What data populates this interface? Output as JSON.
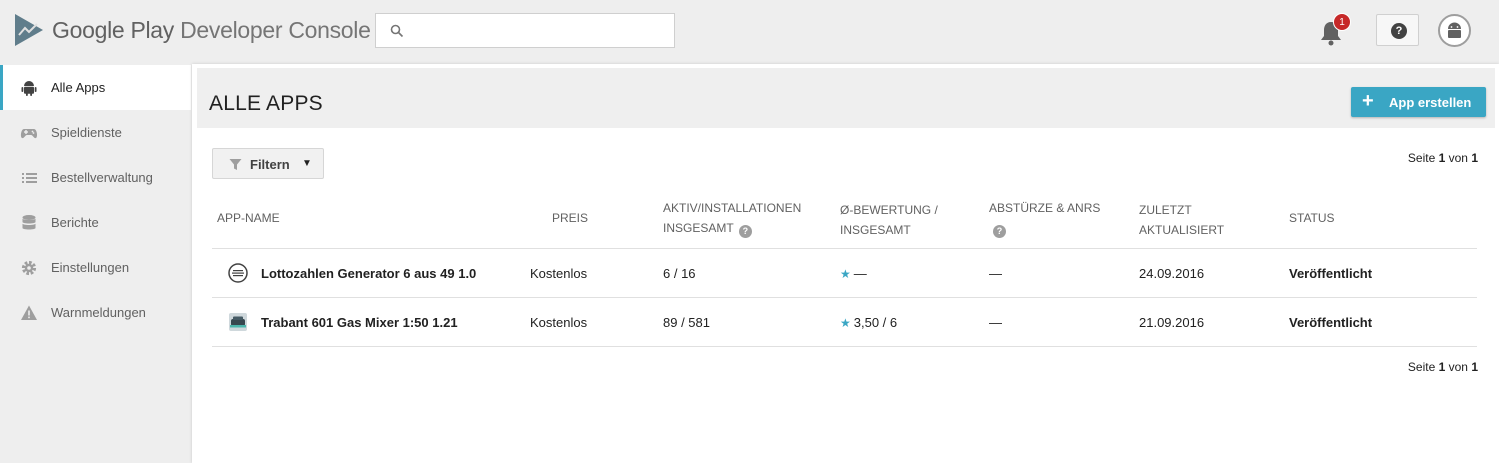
{
  "header": {
    "brand_part1": "Google Play",
    "brand_part2": " Developer Console",
    "search_placeholder": "",
    "notification_count": "1",
    "help_label": "?"
  },
  "sidebar": {
    "items": [
      {
        "label": "Alle Apps",
        "icon": "android-icon",
        "active": true
      },
      {
        "label": "Spieldienste",
        "icon": "gamepad-icon"
      },
      {
        "label": "Bestellverwaltung",
        "icon": "list-icon"
      },
      {
        "label": "Berichte",
        "icon": "database-icon"
      },
      {
        "label": "Einstellungen",
        "icon": "gear-icon"
      },
      {
        "label": "Warnmeldungen",
        "icon": "warning-icon"
      }
    ]
  },
  "main": {
    "title": "ALLE APPS",
    "create_button": "App erstellen",
    "filter_label": "Filtern",
    "pager": {
      "prefix": "Seite ",
      "current": "1",
      "middle": " von ",
      "total": "1"
    },
    "columns": {
      "app_name": "APP-NAME",
      "price": "PREIS",
      "installs_line1": "AKTIV/INSTALLATIONEN",
      "installs_line2": "INSGESAMT",
      "rating_line1": "Ø-BEWERTUNG /",
      "rating_line2": "INSGESAMT",
      "crashes": "ABSTÜRZE & ANRS",
      "updated_line1": "ZULETZT",
      "updated_line2": "AKTUALISIERT",
      "status": "STATUS"
    },
    "apps": [
      {
        "name": "Lottozahlen Generator 6 aus 49 1.0",
        "price": "Kostenlos",
        "installs": "6  /  16",
        "rating": "—",
        "crashes": "—",
        "updated": "24.09.2016",
        "status": "Veröffentlicht"
      },
      {
        "name": "Trabant 601 Gas Mixer 1:50 1.21",
        "price": "Kostenlos",
        "installs": "89  /  581",
        "rating": "3,50  /  6",
        "crashes": "—",
        "updated": "21.09.2016",
        "status": "Veröffentlicht"
      }
    ]
  },
  "colors": {
    "accent": "#3aa6c4",
    "badge": "#c62828",
    "sidebar_bg": "#eeeeee"
  }
}
